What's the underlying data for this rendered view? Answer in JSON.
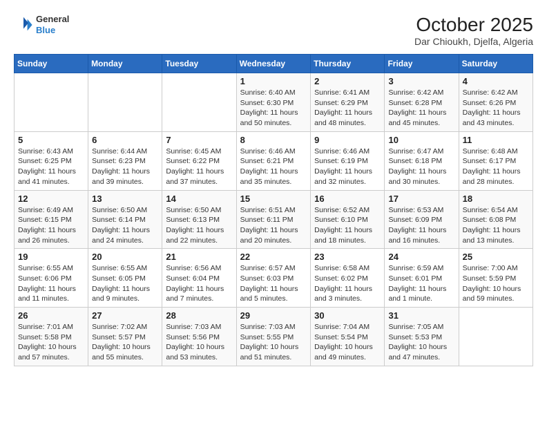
{
  "header": {
    "logo_line1": "General",
    "logo_line2": "Blue",
    "title": "October 2025",
    "subtitle": "Dar Chioukh, Djelfa, Algeria"
  },
  "weekdays": [
    "Sunday",
    "Monday",
    "Tuesday",
    "Wednesday",
    "Thursday",
    "Friday",
    "Saturday"
  ],
  "weeks": [
    [
      {
        "day": "",
        "detail": ""
      },
      {
        "day": "",
        "detail": ""
      },
      {
        "day": "",
        "detail": ""
      },
      {
        "day": "1",
        "detail": "Sunrise: 6:40 AM\nSunset: 6:30 PM\nDaylight: 11 hours and 50 minutes."
      },
      {
        "day": "2",
        "detail": "Sunrise: 6:41 AM\nSunset: 6:29 PM\nDaylight: 11 hours and 48 minutes."
      },
      {
        "day": "3",
        "detail": "Sunrise: 6:42 AM\nSunset: 6:28 PM\nDaylight: 11 hours and 45 minutes."
      },
      {
        "day": "4",
        "detail": "Sunrise: 6:42 AM\nSunset: 6:26 PM\nDaylight: 11 hours and 43 minutes."
      }
    ],
    [
      {
        "day": "5",
        "detail": "Sunrise: 6:43 AM\nSunset: 6:25 PM\nDaylight: 11 hours and 41 minutes."
      },
      {
        "day": "6",
        "detail": "Sunrise: 6:44 AM\nSunset: 6:23 PM\nDaylight: 11 hours and 39 minutes."
      },
      {
        "day": "7",
        "detail": "Sunrise: 6:45 AM\nSunset: 6:22 PM\nDaylight: 11 hours and 37 minutes."
      },
      {
        "day": "8",
        "detail": "Sunrise: 6:46 AM\nSunset: 6:21 PM\nDaylight: 11 hours and 35 minutes."
      },
      {
        "day": "9",
        "detail": "Sunrise: 6:46 AM\nSunset: 6:19 PM\nDaylight: 11 hours and 32 minutes."
      },
      {
        "day": "10",
        "detail": "Sunrise: 6:47 AM\nSunset: 6:18 PM\nDaylight: 11 hours and 30 minutes."
      },
      {
        "day": "11",
        "detail": "Sunrise: 6:48 AM\nSunset: 6:17 PM\nDaylight: 11 hours and 28 minutes."
      }
    ],
    [
      {
        "day": "12",
        "detail": "Sunrise: 6:49 AM\nSunset: 6:15 PM\nDaylight: 11 hours and 26 minutes."
      },
      {
        "day": "13",
        "detail": "Sunrise: 6:50 AM\nSunset: 6:14 PM\nDaylight: 11 hours and 24 minutes."
      },
      {
        "day": "14",
        "detail": "Sunrise: 6:50 AM\nSunset: 6:13 PM\nDaylight: 11 hours and 22 minutes."
      },
      {
        "day": "15",
        "detail": "Sunrise: 6:51 AM\nSunset: 6:11 PM\nDaylight: 11 hours and 20 minutes."
      },
      {
        "day": "16",
        "detail": "Sunrise: 6:52 AM\nSunset: 6:10 PM\nDaylight: 11 hours and 18 minutes."
      },
      {
        "day": "17",
        "detail": "Sunrise: 6:53 AM\nSunset: 6:09 PM\nDaylight: 11 hours and 16 minutes."
      },
      {
        "day": "18",
        "detail": "Sunrise: 6:54 AM\nSunset: 6:08 PM\nDaylight: 11 hours and 13 minutes."
      }
    ],
    [
      {
        "day": "19",
        "detail": "Sunrise: 6:55 AM\nSunset: 6:06 PM\nDaylight: 11 hours and 11 minutes."
      },
      {
        "day": "20",
        "detail": "Sunrise: 6:55 AM\nSunset: 6:05 PM\nDaylight: 11 hours and 9 minutes."
      },
      {
        "day": "21",
        "detail": "Sunrise: 6:56 AM\nSunset: 6:04 PM\nDaylight: 11 hours and 7 minutes."
      },
      {
        "day": "22",
        "detail": "Sunrise: 6:57 AM\nSunset: 6:03 PM\nDaylight: 11 hours and 5 minutes."
      },
      {
        "day": "23",
        "detail": "Sunrise: 6:58 AM\nSunset: 6:02 PM\nDaylight: 11 hours and 3 minutes."
      },
      {
        "day": "24",
        "detail": "Sunrise: 6:59 AM\nSunset: 6:01 PM\nDaylight: 11 hours and 1 minute."
      },
      {
        "day": "25",
        "detail": "Sunrise: 7:00 AM\nSunset: 5:59 PM\nDaylight: 10 hours and 59 minutes."
      }
    ],
    [
      {
        "day": "26",
        "detail": "Sunrise: 7:01 AM\nSunset: 5:58 PM\nDaylight: 10 hours and 57 minutes."
      },
      {
        "day": "27",
        "detail": "Sunrise: 7:02 AM\nSunset: 5:57 PM\nDaylight: 10 hours and 55 minutes."
      },
      {
        "day": "28",
        "detail": "Sunrise: 7:03 AM\nSunset: 5:56 PM\nDaylight: 10 hours and 53 minutes."
      },
      {
        "day": "29",
        "detail": "Sunrise: 7:03 AM\nSunset: 5:55 PM\nDaylight: 10 hours and 51 minutes."
      },
      {
        "day": "30",
        "detail": "Sunrise: 7:04 AM\nSunset: 5:54 PM\nDaylight: 10 hours and 49 minutes."
      },
      {
        "day": "31",
        "detail": "Sunrise: 7:05 AM\nSunset: 5:53 PM\nDaylight: 10 hours and 47 minutes."
      },
      {
        "day": "",
        "detail": ""
      }
    ]
  ]
}
